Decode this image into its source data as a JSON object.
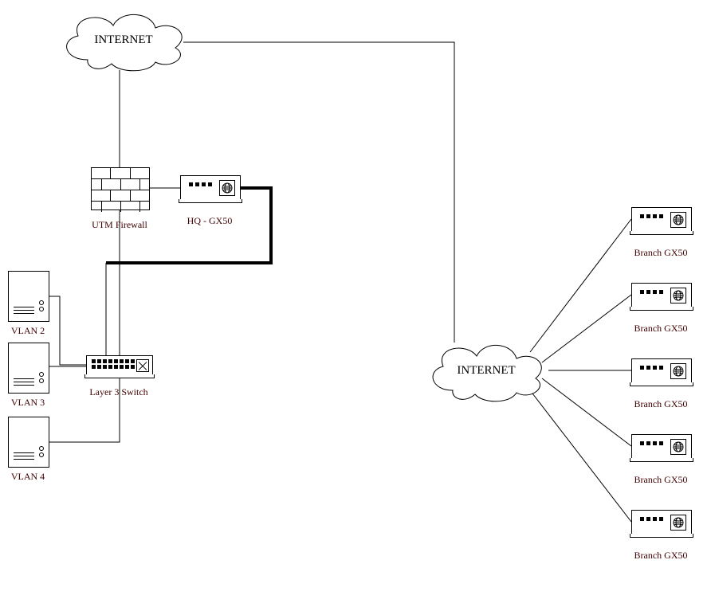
{
  "clouds": {
    "top": {
      "label": "INTERNET"
    },
    "right": {
      "label": "INTERNET"
    }
  },
  "firewall": {
    "label": "UTM Firewall"
  },
  "hqRouter": {
    "label": "HQ - GX50"
  },
  "switch": {
    "label": "Layer 3 Switch"
  },
  "vlans": [
    {
      "label": "VLAN 2"
    },
    {
      "label": "VLAN 3"
    },
    {
      "label": "VLAN 4"
    }
  ],
  "branches": [
    {
      "label": "Branch GX50"
    },
    {
      "label": "Branch GX50"
    },
    {
      "label": "Branch GX50"
    },
    {
      "label": "Branch GX50"
    },
    {
      "label": "Branch GX50"
    }
  ]
}
